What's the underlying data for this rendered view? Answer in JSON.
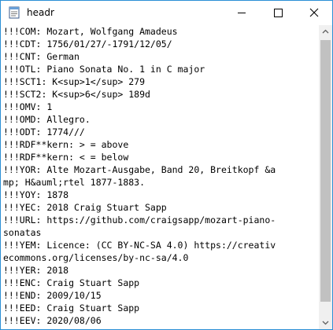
{
  "window": {
    "title": "headr",
    "accent_color": "#2b8fd6"
  },
  "titlebar_buttons": {
    "minimize_icon": "minimize-icon",
    "maximize_icon": "maximize-icon",
    "close_icon": "close-icon"
  },
  "text_lines": [
    "!!!COM: Mozart, Wolfgang Amadeus",
    "!!!CDT: 1756/01/27/-1791/12/05/",
    "!!!CNT: German",
    "!!!OTL: Piano Sonata No. 1 in C major",
    "!!!SCT1: K<sup>1</sup> 279",
    "!!!SCT2: K<sup>6</sup> 189d",
    "!!!OMV: 1",
    "!!!OMD: Allegro.",
    "!!!ODT: 1774///",
    "!!!RDF**kern: > = above",
    "!!!RDF**kern: < = below",
    "!!!YOR: Alte Mozart-Ausgabe, Band 20, Breitkopf &a",
    "mp; H&auml;rtel 1877-1883.",
    "!!!YOY: 1878",
    "!!!YEC: 2018 Craig Stuart Sapp",
    "!!!URL: https://github.com/craigsapp/mozart-piano-",
    "sonatas",
    "!!!YEM: Licence: (CC BY-NC-SA 4.0) https://creativ",
    "ecommons.org/licenses/by-nc-sa/4.0",
    "!!!YER: 2018",
    "!!!ENC: Craig Stuart Sapp",
    "!!!END: 2009/10/15",
    "!!!EED: Craig Stuart Sapp",
    "!!!EEV: 2020/08/06"
  ]
}
